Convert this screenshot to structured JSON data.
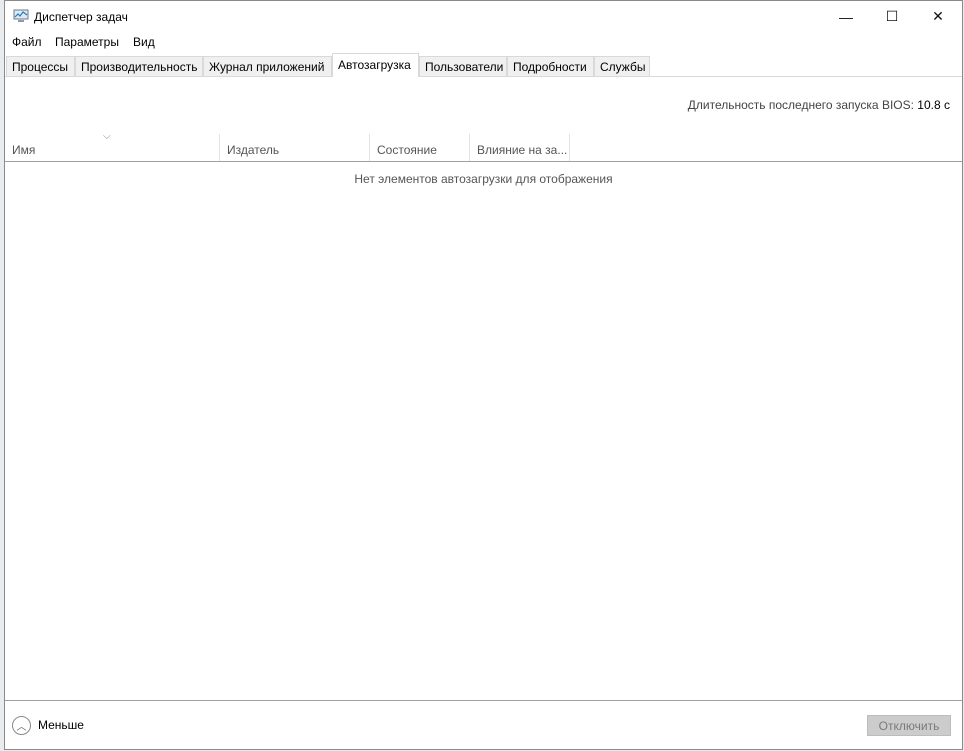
{
  "window": {
    "title": "Диспетчер задач",
    "controls": {
      "minimize": "—",
      "maximize": "☐",
      "close": "✕"
    }
  },
  "menu": [
    "Файл",
    "Параметры",
    "Вид"
  ],
  "tabs": [
    "Процессы",
    "Производительность",
    "Журнал приложений",
    "Автозагрузка",
    "Пользователи",
    "Подробности",
    "Службы"
  ],
  "active_tab": "Автозагрузка",
  "bios": {
    "label": "Длительность последнего запуска BIOS:",
    "value": "10.8 с"
  },
  "columns": [
    "Имя",
    "Издатель",
    "Состояние",
    "Влияние на за..."
  ],
  "empty_message": "Нет элементов автозагрузки для отображения",
  "footer": {
    "less_label": "Меньше",
    "disable_label": "Отключить"
  }
}
